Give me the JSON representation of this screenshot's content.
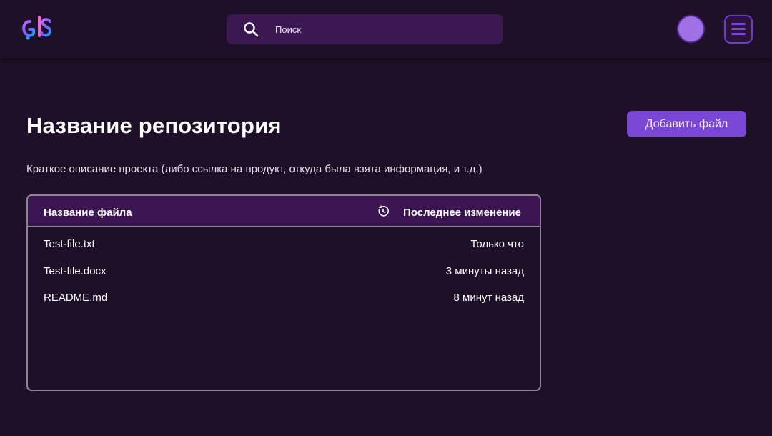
{
  "header": {
    "logo_name": "logo-icon",
    "search": {
      "placeholder": "Поиск",
      "value": ""
    }
  },
  "repo": {
    "title": "Название репозитория",
    "add_file_label": "Добавить файл",
    "description": "Краткое описание проекта (либо ссылка на продукт, откуда была взята информация, и т.д.)"
  },
  "files": {
    "columns": {
      "name": "Название файла",
      "changed": "Последнее изменение"
    },
    "rows": [
      {
        "name": "Test-file.txt",
        "changed": "Только что"
      },
      {
        "name": "Test-file.docx",
        "changed": "3 минуты назад"
      },
      {
        "name": "README.md",
        "changed": "8 минут назад"
      }
    ]
  },
  "colors": {
    "background": "#1f1029",
    "search_bg": "#3c1853",
    "accent": "#7a46d6",
    "avatar": "#a070e6",
    "table_header": "#3b1551"
  }
}
